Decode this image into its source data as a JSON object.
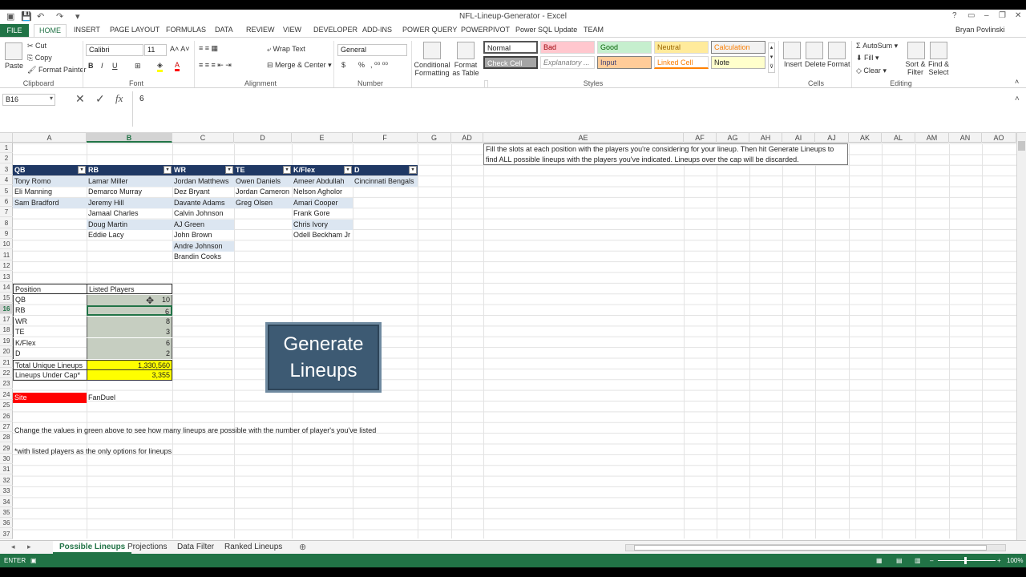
{
  "window": {
    "title": "NFL-Lineup-Generator - Excel",
    "user": "Bryan Povlinski"
  },
  "ribbon_tabs": [
    "FILE",
    "HOME",
    "INSERT",
    "PAGE LAYOUT",
    "FORMULAS",
    "DATA",
    "REVIEW",
    "VIEW",
    "DEVELOPER",
    "ADD-INS",
    "POWER QUERY",
    "POWERPIVOT",
    "Power SQL Update",
    "TEAM"
  ],
  "ribbon": {
    "clipboard": {
      "paste": "Paste",
      "cut": "Cut",
      "copy": "Copy",
      "format_painter": "Format Painter",
      "label": "Clipboard"
    },
    "font": {
      "name": "Calibri",
      "size": "11",
      "label": "Font",
      "bold": "B",
      "italic": "I",
      "underline": "U"
    },
    "alignment": {
      "wrap": "Wrap Text",
      "merge": "Merge & Center",
      "label": "Alignment"
    },
    "number": {
      "format": "General",
      "label": "Number",
      "currency": "$",
      "percent": "%"
    },
    "styles": {
      "conditional": "Conditional Formatting",
      "format_table": "Format as Table",
      "label": "Styles",
      "cells": [
        "Normal",
        "Bad",
        "Good",
        "Neutral",
        "Calculation",
        "Check Cell",
        "Explanatory ...",
        "Input",
        "Linked Cell",
        "Note"
      ]
    },
    "cells_group": {
      "insert": "Insert",
      "delete": "Delete",
      "format": "Format",
      "label": "Cells"
    },
    "editing": {
      "autosum": "AutoSum",
      "fill": "Fill",
      "clear": "Clear",
      "sort": "Sort & Filter",
      "find": "Find & Select",
      "label": "Editing"
    }
  },
  "formula_bar": {
    "name_box": "B16",
    "value": "6"
  },
  "columns": [
    "A",
    "B",
    "C",
    "D",
    "E",
    "F",
    "G",
    "AD",
    "AE",
    "AF",
    "AG",
    "AH",
    "AI",
    "AJ",
    "AK",
    "AL",
    "AM",
    "AN",
    "AO"
  ],
  "rows": [
    "1",
    "2",
    "3",
    "4",
    "5",
    "6",
    "7",
    "8",
    "9",
    "10",
    "11",
    "12",
    "13",
    "14",
    "15",
    "16",
    "17",
    "18",
    "19",
    "20",
    "21",
    "22",
    "23",
    "24",
    "25",
    "26",
    "27",
    "28",
    "29",
    "30",
    "31",
    "32",
    "33",
    "34",
    "35",
    "36",
    "37"
  ],
  "table": {
    "headers": [
      "QB",
      "RB",
      "WR",
      "TE",
      "K/Flex",
      "D"
    ],
    "qb": [
      "Tony Romo",
      "Eli Manning",
      "Sam Bradford"
    ],
    "rb": [
      "Lamar Miller",
      "Demarco Murray",
      "Jeremy Hill",
      "Jamaal Charles",
      "Doug Martin",
      "Eddie Lacy"
    ],
    "wr": [
      "Jordan Matthews",
      "Dez Bryant",
      "Davante Adams",
      "Calvin Johnson",
      "AJ Green",
      "John Brown",
      "Andre Johnson",
      "Brandin Cooks"
    ],
    "te": [
      "Owen Daniels",
      "Jordan Cameron",
      "Greg Olsen"
    ],
    "kflex": [
      "Ameer Abdullah",
      "Nelson Agholor",
      "Amari Cooper",
      "Frank Gore",
      "Chris Ivory",
      "Odell Beckham Jr"
    ],
    "d": [
      "Cincinnati Bengals"
    ]
  },
  "summary": {
    "h_position": "Position",
    "h_listed": "Listed Players",
    "rows": [
      {
        "pos": "QB",
        "val": "10"
      },
      {
        "pos": "RB",
        "val": "6"
      },
      {
        "pos": "WR",
        "val": "8"
      },
      {
        "pos": "TE",
        "val": "3"
      },
      {
        "pos": "K/Flex",
        "val": "6"
      },
      {
        "pos": "D",
        "val": "2"
      }
    ],
    "total_label": "Total Unique Lineups",
    "total_value": "1,330,560",
    "cap_label": "Lineups Under Cap*",
    "cap_value": "3,355",
    "site_label": "Site",
    "site_value": "FanDuel",
    "note1": "Change the values in green above to see how many lineups are possible with the number of player's you've listed",
    "note2": "*with listed players as the only options for lineups"
  },
  "button": {
    "line1": "Generate",
    "line2": "Lineups"
  },
  "instructions": "Fill the slots at each position with the players you're considering for your lineup. Then hit Generate Lineups to find ALL possible lineups with the players you've indicated. Lineups over the cap will be discarded.",
  "sheets": [
    "Possible Lineups",
    "Projections",
    "Data Filter",
    "Ranked Lineups"
  ],
  "status": {
    "mode": "ENTER",
    "zoom": "100%"
  },
  "colors": {
    "excel_green": "#217346",
    "header_navy": "#1f3864",
    "highlight_yellow": "#ffff00",
    "site_red": "#ff0000"
  }
}
